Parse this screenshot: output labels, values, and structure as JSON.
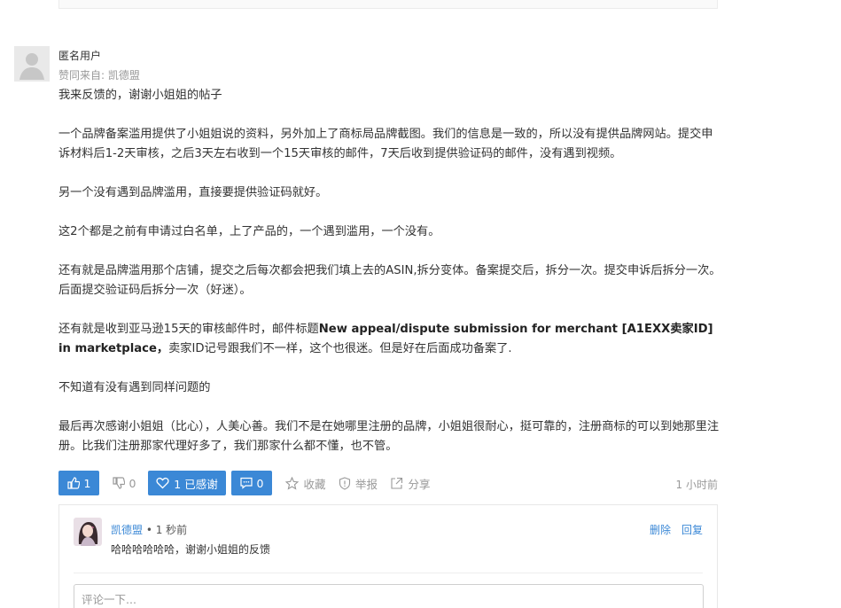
{
  "post": {
    "author": "匿名用户",
    "agree_prefix": "赞同来自:",
    "agree_user": "凯德盟",
    "paragraphs": {
      "p1": "我来反馈的，谢谢小姐姐的帖子",
      "p2": "一个品牌备案滥用提供了小姐姐说的资料，另外加上了商标局品牌截图。我们的信息是一致的，所以没有提供品牌网站。提交申诉材料后1-2天审核，之后3天左右收到一个15天审核的邮件，7天后收到提供验证码的邮件，没有遇到视频。",
      "p3": "另一个没有遇到品牌滥用，直接要提供验证码就好。",
      "p4": "这2个都是之前有申请过白名单，上了产品的，一个遇到滥用，一个没有。",
      "p5": "还有就是品牌滥用那个店铺，提交之后每次都会把我们填上去的ASIN,拆分变体。备案提交后，拆分一次。提交申诉后拆分一次。后面提交验证码后拆分一次（好迷）。",
      "p6_a": "还有就是收到亚马逊15天的审核邮件时，邮件标题",
      "p6_bold": "New appeal/dispute submission for merchant [A1EXX卖家ID] in marketplace，",
      "p6_b": "卖家ID记号跟我们不一样，这个也很迷。但是好在后面成功备案了.",
      "p7": "不知道有没有遇到同样问题的",
      "p8": "最后再次感谢小姐姐（比心），人美心善。我们不是在她哪里注册的品牌，小姐姐很耐心，挺可靠的，注册商标的可以到她那里注册。比我们注册那家代理好多了，我们那家什么都不懂，也不管。"
    }
  },
  "actions": {
    "upvote_count": "1",
    "downvote_count": "0",
    "thanks_label": "1 已感谢",
    "comment_count": "0",
    "collect_label": "收藏",
    "report_label": "举报",
    "share_label": "分享",
    "time": "1 小时前"
  },
  "comment": {
    "author": "凯德盟",
    "time": "• 1 秒前",
    "text": "哈哈哈哈哈哈，谢谢小姐姐的反馈",
    "delete_label": "删除",
    "reply_label": "回复",
    "input_placeholder": "评论一下..."
  },
  "colors": {
    "accent": "#3b88d6",
    "muted": "#999999",
    "text": "#333333"
  },
  "icons": {
    "avatar": "default-user-avatar",
    "upvote": "thumbs-up-icon",
    "downvote": "thumbs-down-icon",
    "thanks": "heart-icon",
    "comment": "comment-icon",
    "collect": "star-icon",
    "report": "shield-icon",
    "share": "share-icon"
  }
}
